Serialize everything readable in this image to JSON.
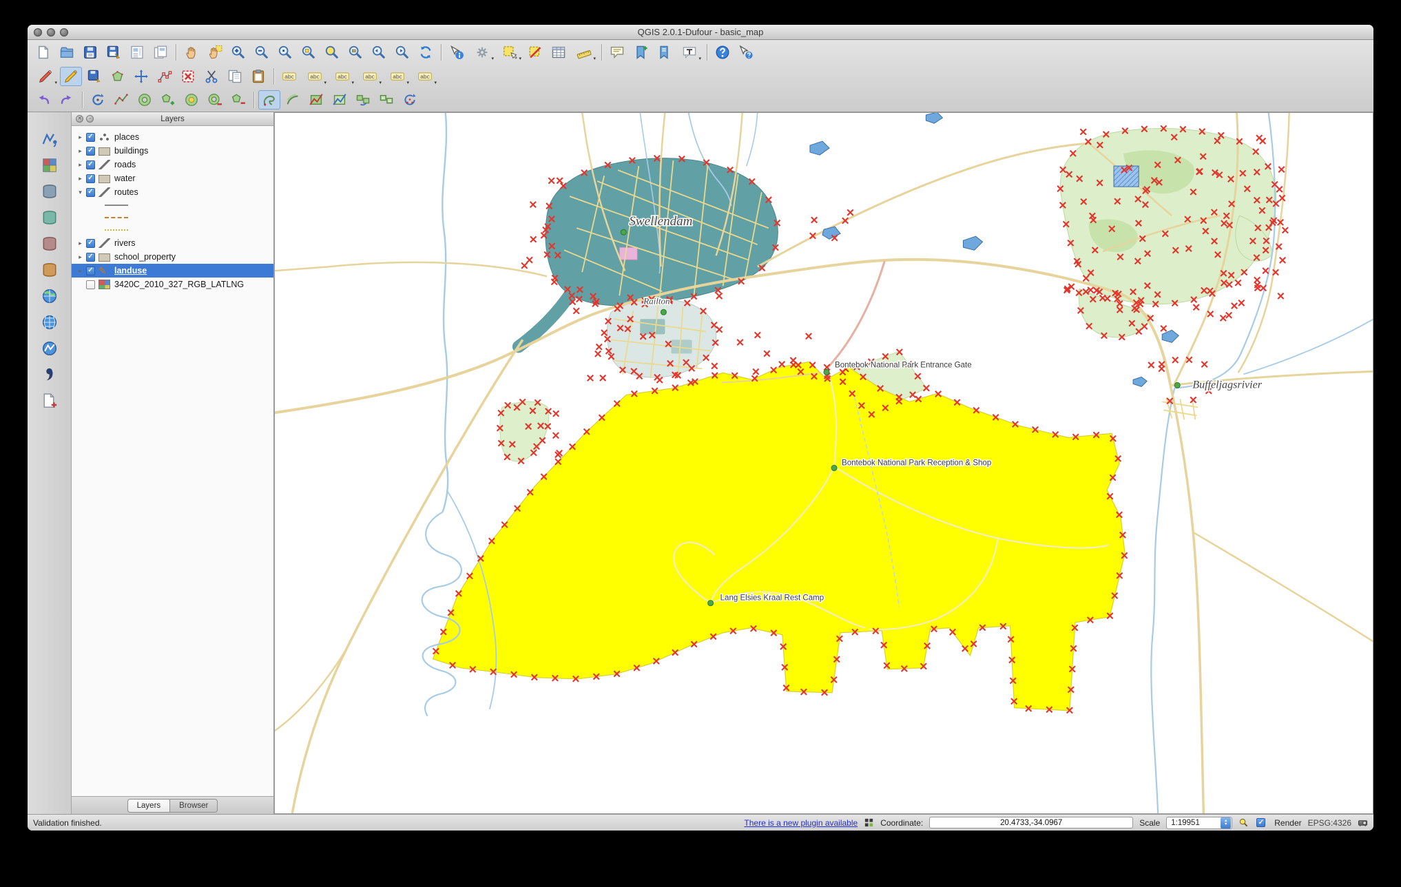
{
  "window": {
    "title": "QGIS 2.0.1-Dufour - basic_map"
  },
  "toolbars": {
    "row1": [
      {
        "name": "new-project",
        "icon": "page"
      },
      {
        "name": "open-project",
        "icon": "folder"
      },
      {
        "name": "save-project",
        "icon": "floppy"
      },
      {
        "name": "save-project-as",
        "icon": "floppy-as"
      },
      {
        "name": "new-print-composer",
        "icon": "composer"
      },
      {
        "name": "composer-manager",
        "icon": "composer-manager",
        "sep": true
      },
      {
        "name": "pan-map",
        "icon": "hand"
      },
      {
        "name": "pan-to-selection",
        "icon": "hand-selection"
      },
      {
        "name": "zoom-in",
        "icon": "zoom-in"
      },
      {
        "name": "zoom-out",
        "icon": "zoom-out"
      },
      {
        "name": "zoom-native",
        "icon": "zoom-native"
      },
      {
        "name": "zoom-full",
        "icon": "zoom-full"
      },
      {
        "name": "zoom-to-selection",
        "icon": "zoom-selection"
      },
      {
        "name": "zoom-to-layer",
        "icon": "zoom-layer"
      },
      {
        "name": "zoom-last",
        "icon": "zoom-last"
      },
      {
        "name": "zoom-next",
        "icon": "zoom-next"
      },
      {
        "name": "refresh-map",
        "icon": "refresh",
        "sep": true
      },
      {
        "name": "identify-features",
        "icon": "identify"
      },
      {
        "name": "run-feature-action",
        "icon": "action",
        "dropdown": true
      },
      {
        "name": "select-features",
        "icon": "select",
        "dropdown": true
      },
      {
        "name": "deselect-all",
        "icon": "deselect"
      },
      {
        "name": "open-attribute-table",
        "icon": "table"
      },
      {
        "name": "measure-line",
        "icon": "measure",
        "dropdown": true,
        "sep": true
      },
      {
        "name": "map-tips",
        "icon": "maptip"
      },
      {
        "name": "new-bookmark",
        "icon": "bookmark-new"
      },
      {
        "name": "show-bookmarks",
        "icon": "bookmark-show"
      },
      {
        "name": "text-annotation",
        "icon": "annotation",
        "dropdown": true,
        "sep": true
      },
      {
        "name": "help-contents",
        "icon": "help"
      },
      {
        "name": "whats-this",
        "icon": "whats-this"
      }
    ],
    "row2": [
      {
        "name": "current-edits",
        "icon": "pencil-red",
        "dropdown": true
      },
      {
        "name": "toggle-editing",
        "icon": "pencil",
        "active": true
      },
      {
        "name": "save-layer-edits",
        "icon": "floppy-pencil"
      },
      {
        "name": "add-feature",
        "icon": "capture-polygon"
      },
      {
        "name": "move-feature",
        "icon": "move-feature"
      },
      {
        "name": "node-tool",
        "icon": "node-tool"
      },
      {
        "name": "delete-selected",
        "icon": "delete-selected"
      },
      {
        "name": "cut-features",
        "icon": "cut"
      },
      {
        "name": "copy-features",
        "icon": "copy"
      },
      {
        "name": "paste-features",
        "icon": "paste",
        "sep": true
      },
      {
        "name": "layer-labeling-options",
        "icon": "label-abc"
      },
      {
        "name": "label-pin",
        "icon": "label-abc",
        "dropdown": true
      },
      {
        "name": "label-show-hide",
        "icon": "label-abc",
        "dropdown": true
      },
      {
        "name": "label-move",
        "icon": "label-abc",
        "dropdown": true
      },
      {
        "name": "label-rotate",
        "icon": "label-abc",
        "dropdown": true
      },
      {
        "name": "label-properties",
        "icon": "label-abc",
        "dropdown": true
      }
    ],
    "row3": [
      {
        "name": "undo",
        "icon": "undo"
      },
      {
        "name": "redo",
        "icon": "redo",
        "sep": true
      },
      {
        "name": "rotate-feature",
        "icon": "rotate-feature"
      },
      {
        "name": "simplify-feature",
        "icon": "simplify"
      },
      {
        "name": "add-ring",
        "icon": "add-ring"
      },
      {
        "name": "add-part",
        "icon": "add-part"
      },
      {
        "name": "fill-ring",
        "icon": "fill-ring"
      },
      {
        "name": "delete-ring",
        "icon": "delete-ring"
      },
      {
        "name": "delete-part",
        "icon": "delete-part",
        "sep": true
      },
      {
        "name": "reshape-features",
        "icon": "reshape",
        "active": true
      },
      {
        "name": "offset-curve",
        "icon": "offset-curve"
      },
      {
        "name": "split-features",
        "icon": "split-features"
      },
      {
        "name": "split-parts",
        "icon": "split-parts"
      },
      {
        "name": "merge-features",
        "icon": "merge"
      },
      {
        "name": "merge-attributes",
        "icon": "merge-attrs"
      },
      {
        "name": "rotate-point-symbols",
        "icon": "rotate-points"
      }
    ],
    "left": [
      {
        "name": "add-vector-layer",
        "icon": "layer-vector"
      },
      {
        "name": "add-raster-layer",
        "icon": "layer-raster"
      },
      {
        "name": "add-postgis-layer",
        "icon": "db-postgis"
      },
      {
        "name": "add-spatialite-layer",
        "icon": "db-spatialite"
      },
      {
        "name": "add-mssql-layer",
        "icon": "db-mssql"
      },
      {
        "name": "add-oracle-layer",
        "icon": "db-oracle"
      },
      {
        "name": "add-wms-layer",
        "icon": "globe-wms"
      },
      {
        "name": "add-wcs-layer",
        "icon": "globe-wcs"
      },
      {
        "name": "add-wfs-layer",
        "icon": "globe-wfs"
      },
      {
        "name": "add-delimited-text-layer",
        "icon": "comma"
      },
      {
        "name": "new-shapefile-layer",
        "icon": "new-shapefile"
      }
    ]
  },
  "layers_panel": {
    "title": "Layers",
    "tree": [
      {
        "label": "places",
        "checked": true,
        "arrow": "right",
        "icon": "points"
      },
      {
        "label": "buildings",
        "checked": true,
        "arrow": "right",
        "icon": "polygon"
      },
      {
        "label": "roads",
        "checked": true,
        "arrow": "right",
        "icon": "line"
      },
      {
        "label": "water",
        "checked": true,
        "arrow": "right",
        "icon": "polygon"
      },
      {
        "label": "routes",
        "checked": true,
        "arrow": "down",
        "icon": "line"
      },
      {
        "type": "symbol",
        "swatch": "line-solid"
      },
      {
        "type": "symbol",
        "swatch": "line-dash"
      },
      {
        "type": "symbol",
        "swatch": "line-dot"
      },
      {
        "label": "rivers",
        "checked": true,
        "arrow": "right",
        "icon": "line"
      },
      {
        "label": "school_property",
        "checked": true,
        "arrow": "right",
        "icon": "polygon"
      },
      {
        "label": "landuse",
        "checked": true,
        "arrow": "right",
        "icon": "pencil",
        "selected": true
      },
      {
        "label": "3420C_2010_327_RGB_LATLNG",
        "checked": false,
        "arrow": "none",
        "icon": "raster"
      }
    ],
    "tabs": [
      {
        "label": "Layers",
        "active": true
      },
      {
        "label": "Browser",
        "active": false
      }
    ]
  },
  "map": {
    "labels": {
      "town": "Swellendam",
      "suburb": "Railton",
      "gate": "Bontebok National Park Entrance Gate",
      "reception": "Bontebok National Park Reception & Shop",
      "camp": "Lang Elsies Kraal Rest Camp",
      "village": "Buffeljagsrivier"
    },
    "vertex_clusters": [
      [
        1148,
        28,
        312,
        250,
        80
      ],
      [
        1160,
        252,
        130,
        62,
        12
      ],
      [
        358,
        95,
        58,
        165,
        12
      ],
      [
        424,
        256,
        222,
        140,
        30
      ],
      [
        640,
        318,
        168,
        66,
        12
      ],
      [
        305,
        408,
        118,
        108,
        10
      ],
      [
        1270,
        358,
        88,
        66,
        9
      ],
      [
        1332,
        224,
        72,
        96,
        8
      ],
      [
        762,
        142,
        80,
        64,
        5
      ],
      [
        1398,
        96,
        72,
        150,
        8
      ]
    ]
  },
  "status_bar": {
    "message": "Validation finished.",
    "plugin_link": "There is a new plugin available",
    "coordinate_label": "Coordinate:",
    "coordinate_value": "20.4733,-34.0967",
    "scale_label": "Scale",
    "scale_value": "1:19951",
    "render_label": "Render",
    "crs": "EPSG:4326"
  },
  "colors": {
    "selection_highlight": "#ffff00",
    "vertex_marker": "#e2352b",
    "row_selected": "#3d7ad6",
    "urban_fill": "#61a0a4",
    "park_green": "#dcefca",
    "road": "#e7d49c",
    "river": "#a8cbe6"
  }
}
